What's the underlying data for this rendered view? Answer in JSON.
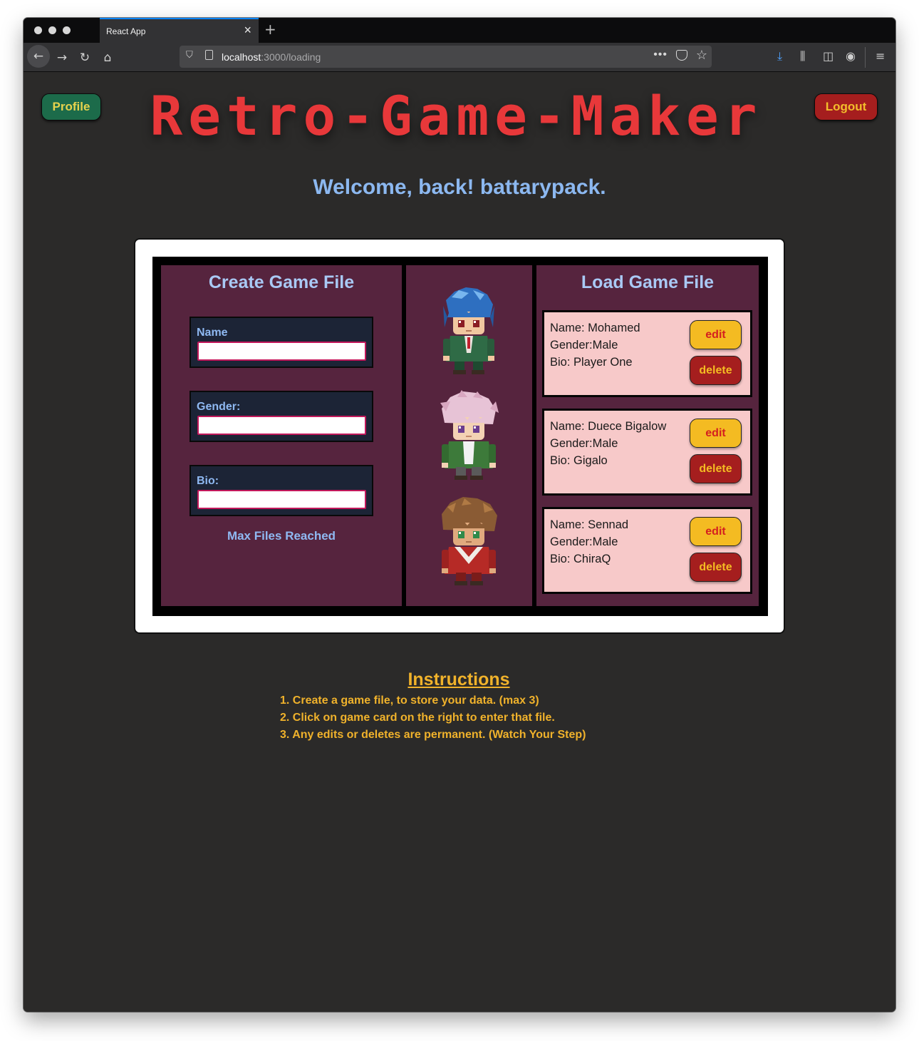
{
  "browser": {
    "tab_title": "React App",
    "url_host": "localhost",
    "url_path": ":3000/loading"
  },
  "header": {
    "profile_label": "Profile",
    "logout_label": "Logout",
    "title": "Retro-Game-Maker",
    "welcome": "Welcome, back! battarypack."
  },
  "create_panel": {
    "title": "Create Game File",
    "name_label": "Name",
    "name_value": "",
    "gender_label": "Gender:",
    "gender_value": "",
    "bio_label": "Bio:",
    "bio_value": "",
    "status": "Max Files Reached"
  },
  "load_panel": {
    "title": "Load Game File",
    "edit_label": "edit",
    "delete_label": "delete",
    "files": [
      {
        "name": "Name: Mohamed",
        "gender": "Gender:Male",
        "bio": "Bio: Player One"
      },
      {
        "name": "Name: Duece Bigalow",
        "gender": "Gender:Male",
        "bio": "Bio: Gigalo"
      },
      {
        "name": "Name: Sennad",
        "gender": "Gender:Male",
        "bio": "Bio: ChiraQ"
      }
    ]
  },
  "sprites": [
    "blue-haired-hero-sprite",
    "pink-haired-hero-sprite",
    "brown-haired-hero-sprite"
  ],
  "instructions": {
    "title": "Instructions",
    "steps": [
      "1. Create a game file, to store your data. (max 3)",
      "2. Click on game card on the right to enter that file.",
      "3. Any edits or deletes are permanent. (Watch Your Step)"
    ]
  },
  "colors": {
    "page_bg": "#2b2a29",
    "title_red": "#e8383a",
    "panel_purple": "#56243e",
    "card_pink": "#f7c9c9",
    "accent_yellow": "#f4bb22",
    "danger_red": "#a51e1e",
    "profile_green": "#1c6b4a",
    "link_blue": "#8cb8f0"
  }
}
